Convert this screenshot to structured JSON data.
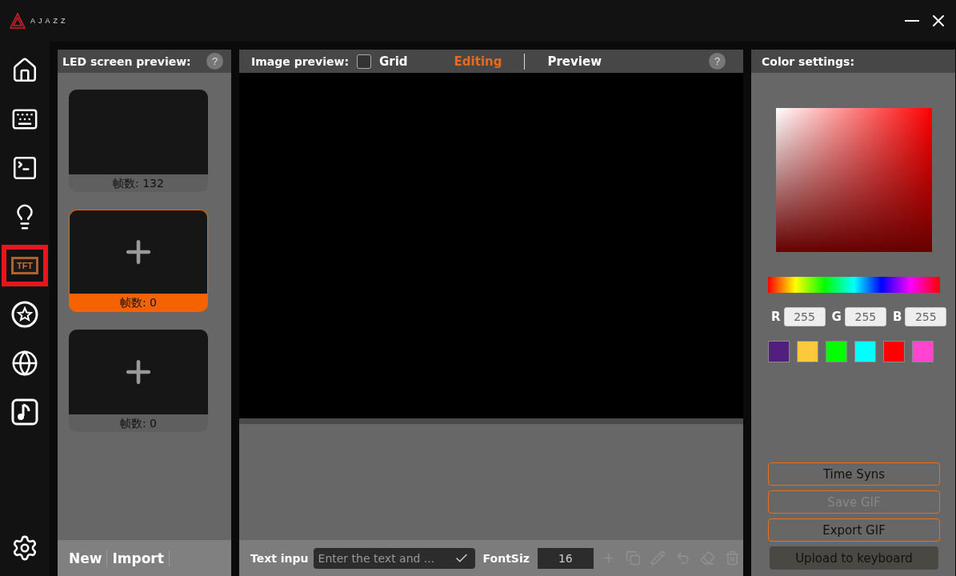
{
  "app": {
    "logo_text": "AJAZZ"
  },
  "nav": [
    {
      "kind": "home",
      "selected": false
    },
    {
      "kind": "keyboard",
      "selected": false
    },
    {
      "kind": "terminal",
      "selected": false
    },
    {
      "kind": "light",
      "selected": false
    },
    {
      "kind": "tft",
      "label": "TFT",
      "selected": true
    },
    {
      "kind": "star",
      "selected": false
    },
    {
      "kind": "disco",
      "selected": false
    },
    {
      "kind": "music",
      "selected": false
    },
    {
      "kind": "settings",
      "selected": false
    }
  ],
  "led_panel": {
    "title": "LED screen preview:",
    "help": "?",
    "frames": [
      {
        "kind": "filled",
        "label": "帧数: 132",
        "selected": false
      },
      {
        "kind": "empty",
        "label": "帧数: 0",
        "selected": true
      },
      {
        "kind": "empty",
        "label": "帧数: 0",
        "selected": false
      }
    ],
    "actions": [
      "New",
      "Import"
    ]
  },
  "image_panel": {
    "title": "Image preview:",
    "grid": {
      "label": "Grid",
      "checked": false
    },
    "tabs": [
      {
        "label": "Editing",
        "selected": true
      },
      {
        "label": "Preview",
        "selected": false
      }
    ],
    "help": "?",
    "text_input": {
      "label": "Text inpu",
      "placeholder": "Enter the text and ..."
    },
    "font_size": {
      "label": "FontSiz",
      "value": "16"
    },
    "tools": [
      {
        "kind": "add",
        "disabled": true
      },
      {
        "kind": "copy",
        "disabled": true
      },
      {
        "kind": "edit",
        "disabled": true
      },
      {
        "kind": "undo",
        "disabled": true
      },
      {
        "kind": "erase",
        "disabled": true
      },
      {
        "kind": "delete",
        "disabled": true
      }
    ]
  },
  "color_panel": {
    "title": "Color settings:",
    "rgb": [
      {
        "label": "R",
        "value": "255"
      },
      {
        "label": "G",
        "value": "255"
      },
      {
        "label": "B",
        "value": "255"
      }
    ],
    "swatches": [
      {
        "color": "#531f7e"
      },
      {
        "color": "#fdc93c"
      },
      {
        "color": "#00ff00"
      },
      {
        "color": "#00ffff"
      },
      {
        "color": "#ff0000"
      },
      {
        "color": "#ff44d0"
      }
    ],
    "buttons": [
      {
        "kind": "outline",
        "label": "Time Syns",
        "disabled": false
      },
      {
        "kind": "outline",
        "label": "Save GIF",
        "disabled": true
      },
      {
        "kind": "outline",
        "label": "Export GIF",
        "disabled": false
      },
      {
        "kind": "filled",
        "label": "Upload to keyboard",
        "disabled": false
      }
    ]
  }
}
